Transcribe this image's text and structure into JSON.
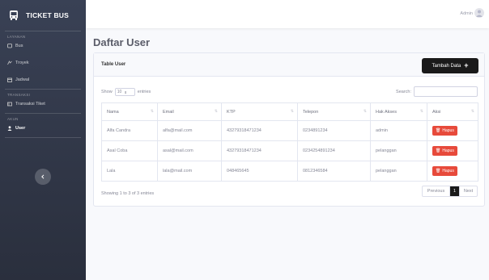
{
  "brand": {
    "title": "TICKET BUS"
  },
  "sidebar": {
    "sections": [
      {
        "heading": "LAYANAN",
        "items": [
          {
            "label": "Bus",
            "icon": "bus-icon"
          },
          {
            "label": "Troyek",
            "icon": "route-icon"
          },
          {
            "label": "Jadwal",
            "icon": "calendar-icon"
          }
        ]
      },
      {
        "heading": "TRANSAKSI",
        "items": [
          {
            "label": "Transaksi Tiket",
            "icon": "ticket-icon"
          }
        ]
      },
      {
        "heading": "AKUN",
        "items": [
          {
            "label": "User",
            "icon": "user-icon",
            "active": true
          }
        ]
      }
    ]
  },
  "topbar": {
    "user_name": "Admin"
  },
  "page": {
    "title": "Daftar User"
  },
  "card": {
    "title": "Table User",
    "add_button": "Tambah Data",
    "show_prefix": "Show",
    "show_value": "10",
    "show_suffix": "entries",
    "search_label": "Search:",
    "columns": [
      "Nama",
      "Email",
      "KTP",
      "Telepon",
      "Hak Akses",
      "Aksi"
    ],
    "rows": [
      {
        "nama": "Alfa Candra",
        "email": "alfa@mail.com",
        "ktp": "43279318471234",
        "telepon": "0234891234",
        "akses": "admin",
        "aksi": "Hapus"
      },
      {
        "nama": "Asal Coba",
        "email": "asal@mail.com",
        "ktp": "43279318471234",
        "telepon": "0234254891234",
        "akses": "pelanggan",
        "aksi": "Hapus"
      },
      {
        "nama": "Lala",
        "email": "lala@mail.com",
        "ktp": "048465645",
        "telepon": "0812346584",
        "akses": "pelanggan",
        "aksi": "Hapus"
      }
    ],
    "info": "Showing 1 to 3 of 3 entries",
    "pagination": {
      "prev": "Previous",
      "current": "1",
      "next": "Next"
    }
  },
  "colors": {
    "sidebar": "#394155",
    "accent": "#1a1a1a",
    "danger": "#e74a3b"
  }
}
